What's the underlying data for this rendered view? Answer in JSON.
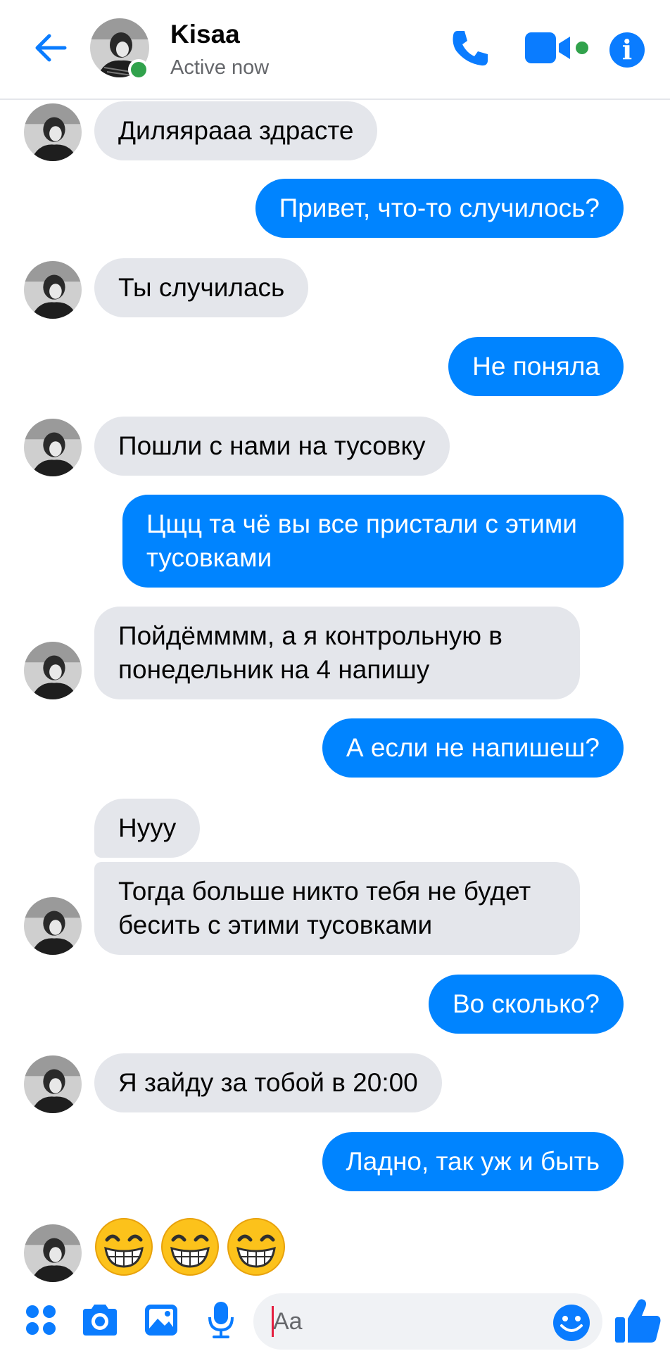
{
  "header": {
    "contact_name": "Kisaa",
    "status": "Active now",
    "icons": [
      "back-arrow-icon",
      "phone-icon",
      "video-camera-icon",
      "info-icon"
    ]
  },
  "messages": [
    {
      "side": "in",
      "text": "Диляяраaa здрасте"
    },
    {
      "side": "out",
      "text": "Привет, что-то случилось?"
    },
    {
      "side": "in",
      "text": "Ты случилась"
    },
    {
      "side": "out",
      "text": "Не поняла"
    },
    {
      "side": "in",
      "text": "Пошли с нами на тусовку"
    },
    {
      "side": "out",
      "text": "Цщц та чё вы все пристали с этими тусовками"
    },
    {
      "side": "in",
      "text": "Пойдёмммм, а я контрольную в понедельник на 4 напишу"
    },
    {
      "side": "out",
      "text": "А если не напишеш?"
    },
    {
      "side": "in",
      "text": "Нууу"
    },
    {
      "side": "in",
      "text": "Тогда больше никто тебя не будет бесить с этими тусовками"
    },
    {
      "side": "out",
      "text": "Во сколько?"
    },
    {
      "side": "in",
      "text": "Я зайду за тобой в 20:00"
    },
    {
      "side": "out",
      "text": "Ладно, так уж и быть"
    },
    {
      "side": "in",
      "text": "😁😁😁"
    }
  ],
  "composer": {
    "placeholder": "Aa",
    "icons": [
      "menu-dots-icon",
      "camera-icon",
      "gallery-icon",
      "microphone-icon",
      "emoji-icon",
      "like-icon"
    ]
  },
  "colors": {
    "accent": "#0084ff",
    "incoming_bubble": "#e4e6eb",
    "online": "#31a24c"
  }
}
